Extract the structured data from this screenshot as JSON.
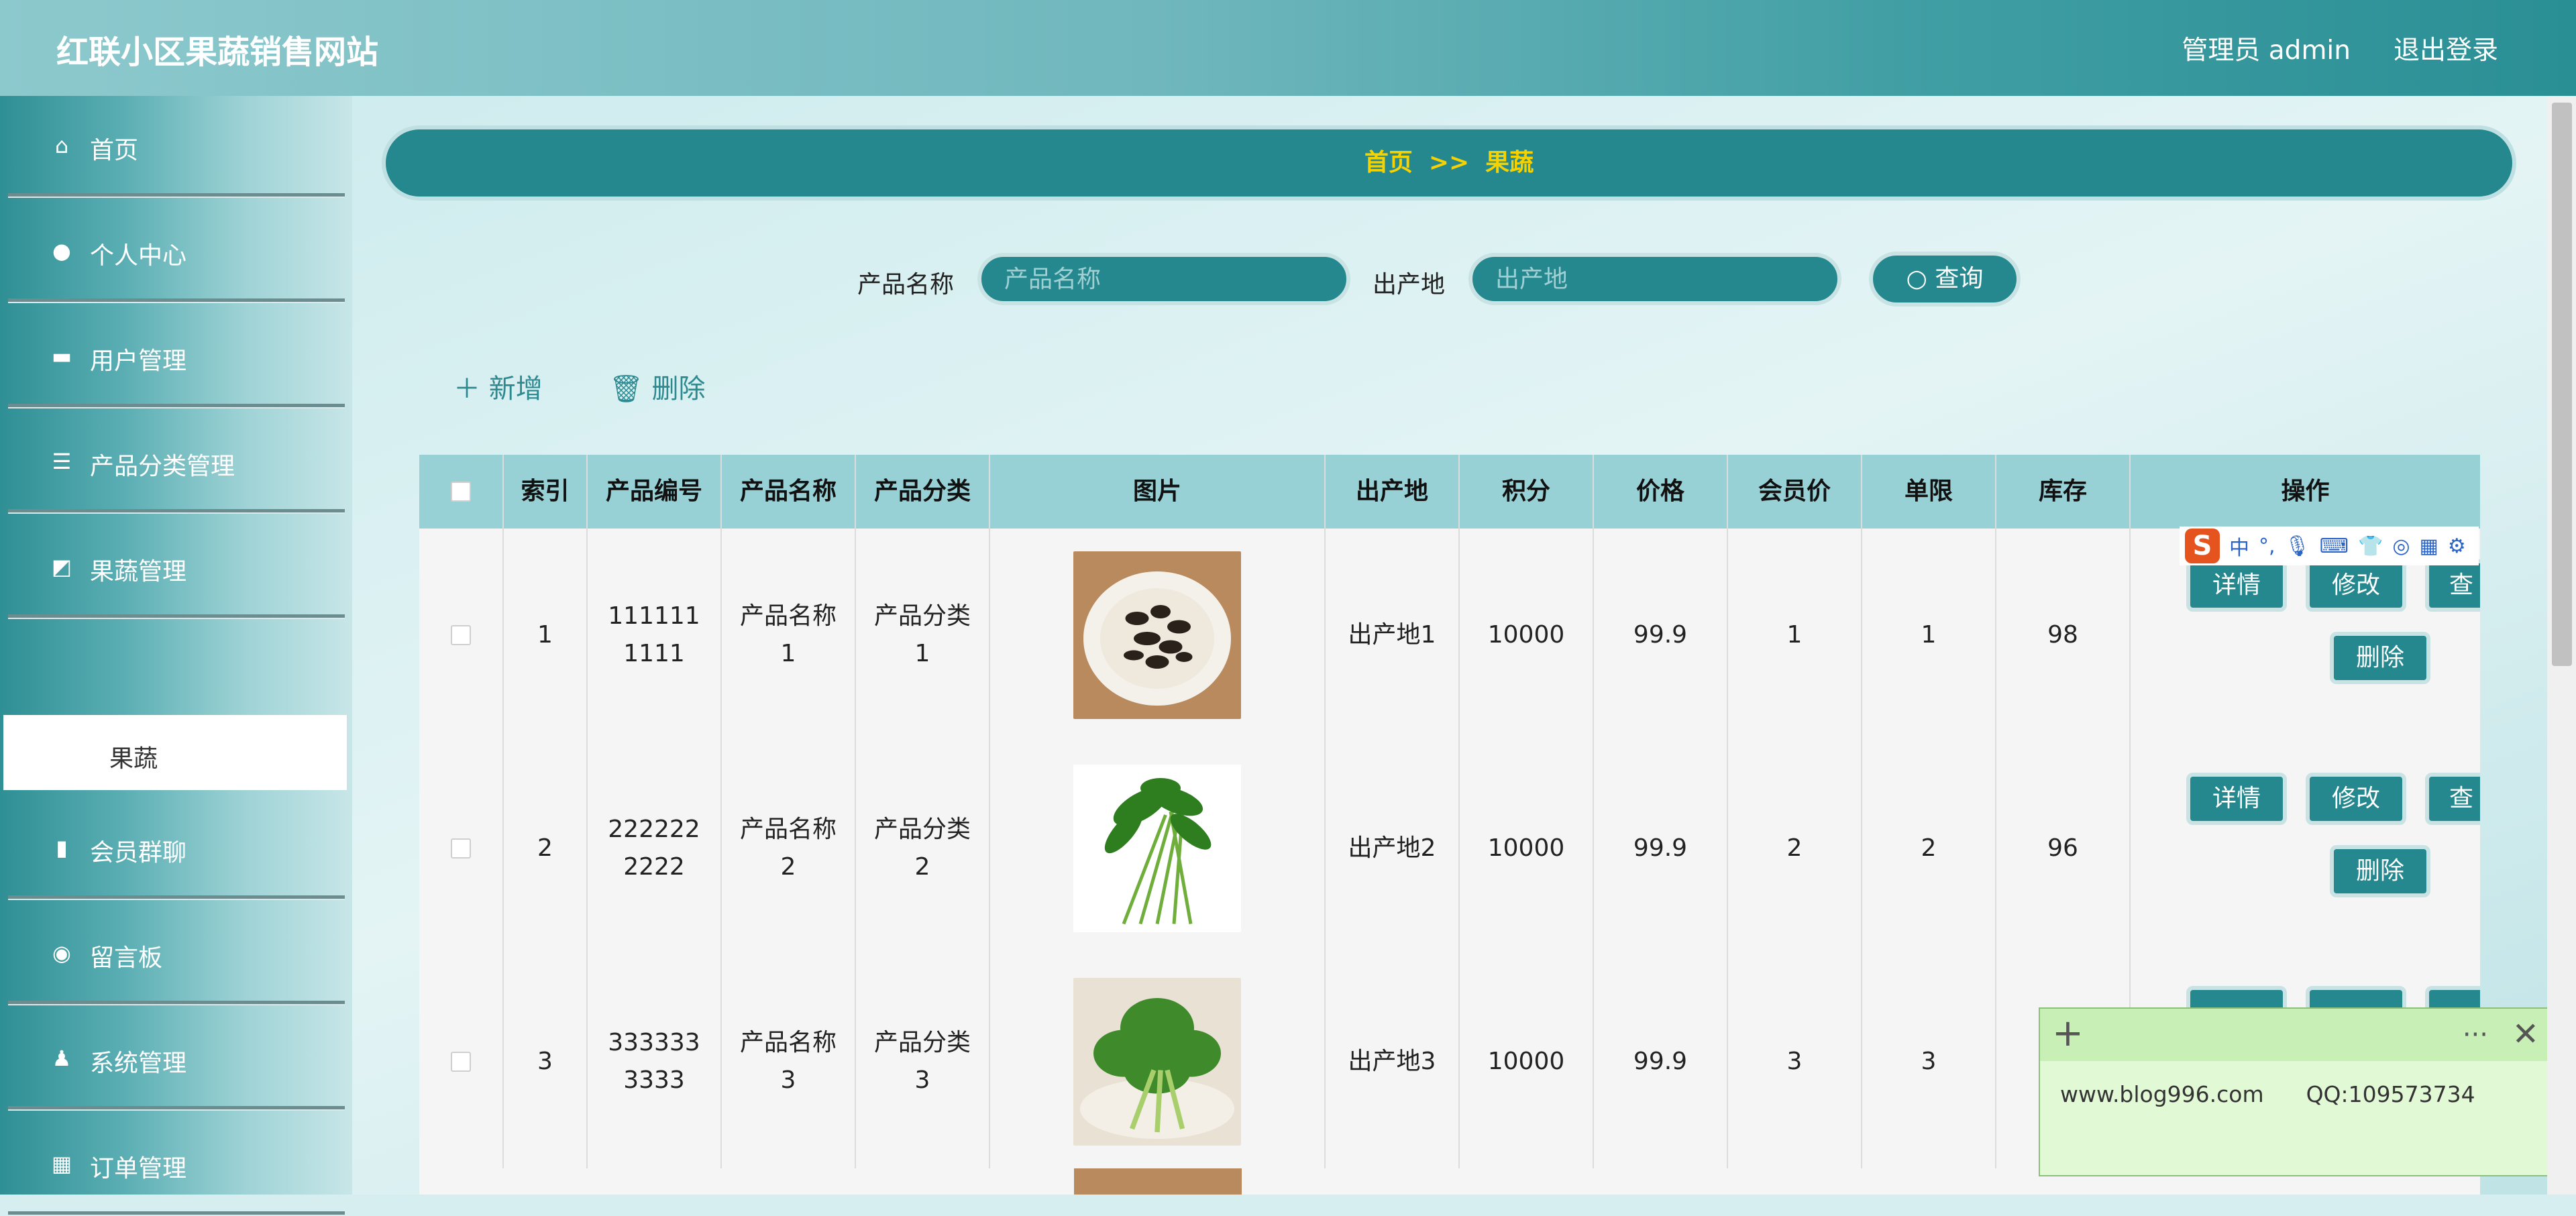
{
  "header": {
    "site_title": "红联小区果蔬销售网站",
    "admin_label": "管理员 admin",
    "logout_label": "退出登录"
  },
  "sidebar": {
    "items": [
      {
        "label": "首页",
        "icon": "home-icon",
        "has_chevron": false
      },
      {
        "label": "个人中心",
        "icon": "user-icon",
        "has_chevron": true
      },
      {
        "label": "用户管理",
        "icon": "monitor-icon",
        "has_chevron": true
      },
      {
        "label": "产品分类管理",
        "icon": "list-icon",
        "has_chevron": true
      },
      {
        "label": "果蔬管理",
        "icon": "chart-icon",
        "has_chevron": true
      },
      {
        "label": "会员群聊",
        "icon": "book-icon",
        "has_chevron": true
      },
      {
        "label": "留言板",
        "icon": "bulb-icon",
        "has_chevron": true
      },
      {
        "label": "系统管理",
        "icon": "person-icon",
        "has_chevron": true
      },
      {
        "label": "订单管理",
        "icon": "grid-icon",
        "has_chevron": true
      }
    ],
    "active_sub_item": "果蔬"
  },
  "breadcrumb": {
    "home": "首页",
    "separator": ">>",
    "current": "果蔬"
  },
  "search": {
    "product_name_label": "产品名称",
    "product_name_placeholder": "产品名称",
    "origin_label": "出产地",
    "origin_placeholder": "出产地",
    "query_label": "查询"
  },
  "toolbar": {
    "add_label": "新增",
    "delete_label": "删除"
  },
  "table": {
    "columns": [
      "索引",
      "产品编号",
      "产品名称",
      "产品分类",
      "图片",
      "出产地",
      "积分",
      "价格",
      "会员价",
      "单限",
      "库存",
      "操作"
    ],
    "rows": [
      {
        "index": "1",
        "code": "1111111111",
        "name": "产品名称1",
        "category": "产品分类1",
        "origin": "出产地1",
        "points": "10000",
        "price": "99.9",
        "member_price": "1",
        "limit": "1",
        "stock": "98",
        "image": "black-mushroom"
      },
      {
        "index": "2",
        "code": "2222222222",
        "name": "产品名称2",
        "category": "产品分类2",
        "origin": "出产地2",
        "points": "10000",
        "price": "99.9",
        "member_price": "2",
        "limit": "2",
        "stock": "96",
        "image": "water-spinach"
      },
      {
        "index": "3",
        "code": "3333333333",
        "name": "产品名称3",
        "category": "产品分类3",
        "origin": "出产地3",
        "points": "10000",
        "price": "99.9",
        "member_price": "3",
        "limit": "3",
        "stock": "",
        "image": "kale"
      }
    ],
    "actions": {
      "detail": "详情",
      "edit": "修改",
      "view": "查",
      "delete": "删除"
    }
  },
  "ime_toolbar": {
    "logo": "S",
    "mode": "中"
  },
  "sticky_note": {
    "text": "www.blog996.com      QQ:109573734"
  },
  "colors": {
    "primary": "#24888e",
    "accent_text": "#f6d200",
    "header_dark": "#2a8f95"
  }
}
